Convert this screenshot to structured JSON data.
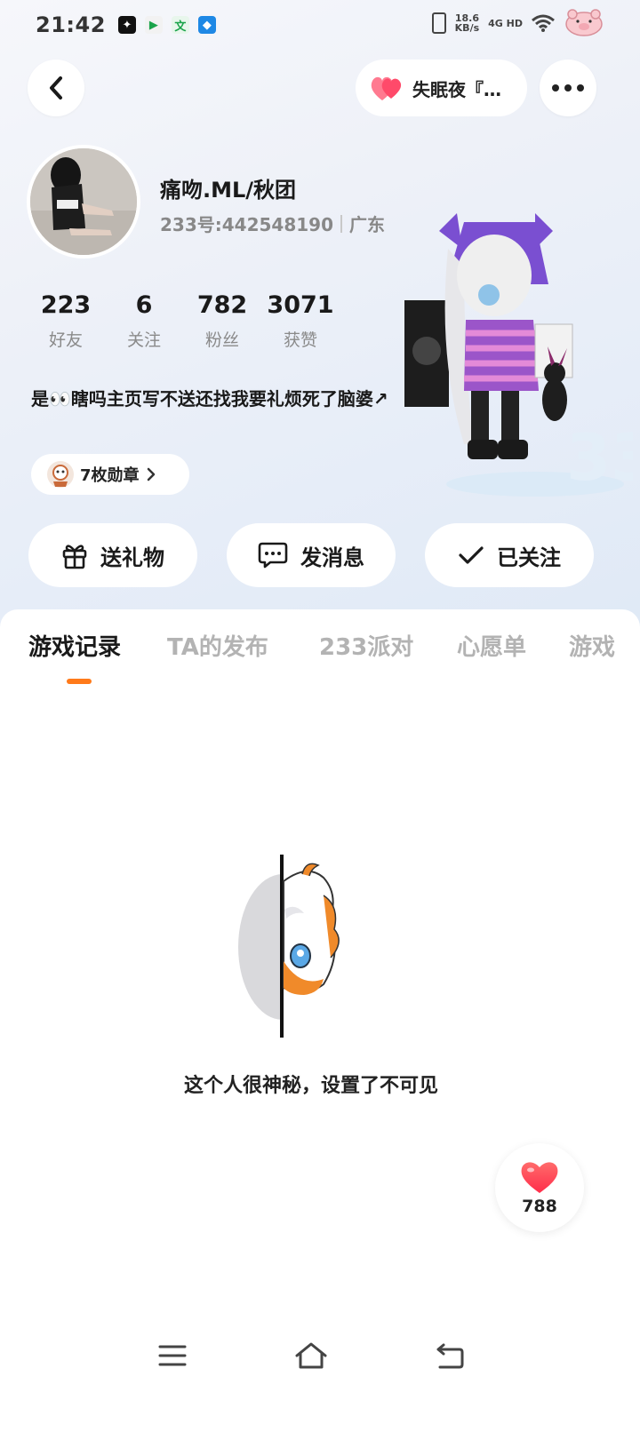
{
  "status_bar": {
    "time": "21:42",
    "net_speed": "18.6",
    "net_speed_unit": "KB/s",
    "network": "4G HD"
  },
  "header": {
    "cp_label": "失眠夜『…"
  },
  "profile": {
    "username": "痛吻.ML/秋团",
    "uid": "233号:442548190",
    "location": "广东",
    "bio": "是👀瞎吗主页写不送还找我要礼烦死了脑婆↗",
    "medal_label": "7枚勋章"
  },
  "stats": [
    {
      "value": "223",
      "label": "好友"
    },
    {
      "value": "6",
      "label": "关注"
    },
    {
      "value": "782",
      "label": "粉丝"
    },
    {
      "value": "3071",
      "label": "获赞"
    }
  ],
  "actions": {
    "gift": "送礼物",
    "message": "发消息",
    "followed": "已关注"
  },
  "tabs": [
    "游戏记录",
    "TA的发布",
    "233派对",
    "心愿单",
    "游戏"
  ],
  "empty_state": {
    "text": "这个人很神秘，设置了不可见"
  },
  "like_fab": {
    "count": "788"
  },
  "colors": {
    "accent": "#ff7a1a",
    "heart": "#ff4a5c"
  }
}
